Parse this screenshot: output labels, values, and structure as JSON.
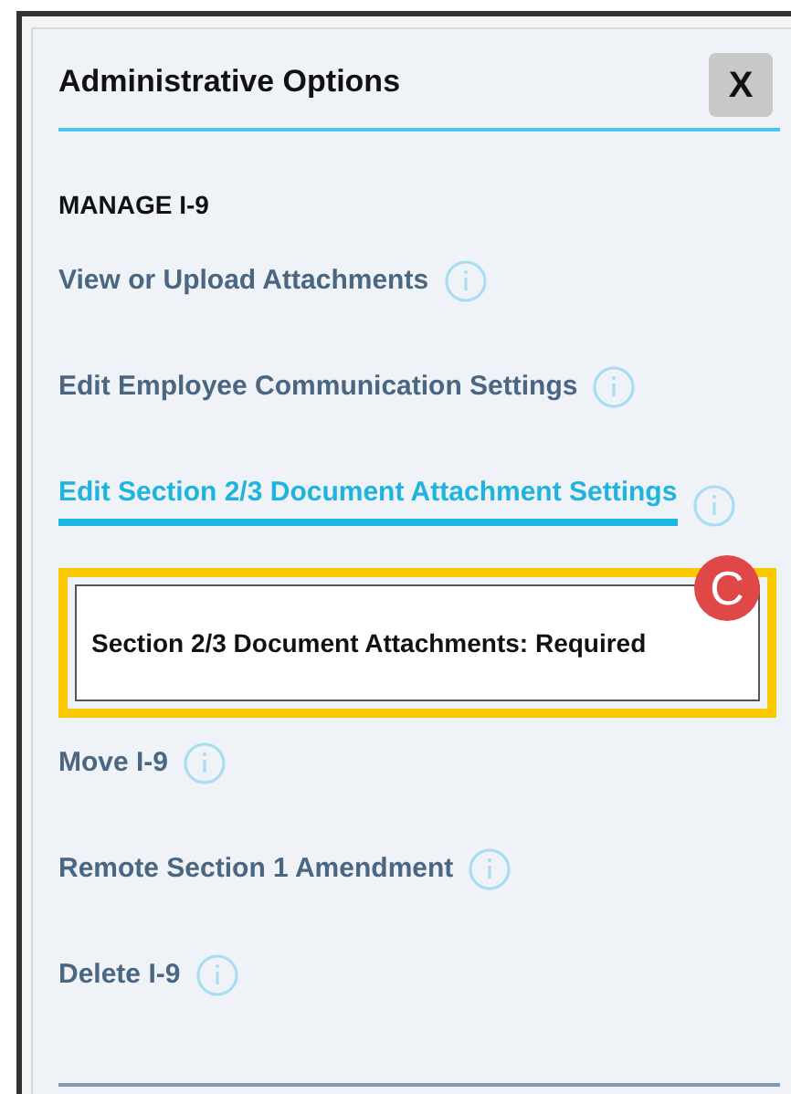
{
  "dialog": {
    "title": "Administrative Options",
    "close_label": "X"
  },
  "section": {
    "heading": "MANAGE I-9"
  },
  "options": [
    {
      "kind": "link",
      "label": "View or Upload Attachments",
      "selected": false
    },
    {
      "kind": "link",
      "label": "Edit Employee Communication Settings",
      "selected": false
    },
    {
      "kind": "link",
      "label": "Edit Section 2/3 Document Attachment Settings",
      "selected": true
    },
    {
      "kind": "detail",
      "label": "Section 2/3 Document Attachments: Required",
      "callout": "C"
    },
    {
      "kind": "link",
      "label": "Move I-9",
      "selected": false
    },
    {
      "kind": "link",
      "label": "Remote Section 1 Amendment",
      "selected": false
    },
    {
      "kind": "link",
      "label": "Delete I-9",
      "selected": false
    }
  ]
}
